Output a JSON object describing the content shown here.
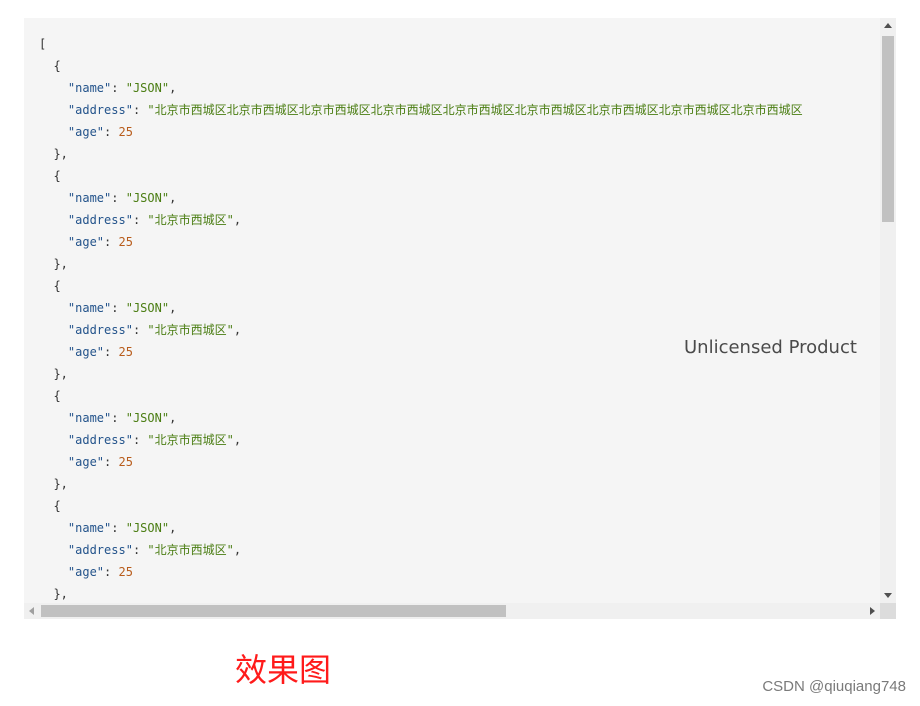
{
  "viewer": {
    "watermark": "Unlicensed Product",
    "lines": [
      [
        {
          "t": "p",
          "v": "["
        }
      ],
      [
        {
          "t": "p",
          "v": "  {"
        }
      ],
      [
        {
          "t": "p",
          "v": "    "
        },
        {
          "t": "k",
          "v": "\"name\""
        },
        {
          "t": "p",
          "v": ": "
        },
        {
          "t": "s",
          "v": "\"JSON\""
        },
        {
          "t": "p",
          "v": ","
        }
      ],
      [
        {
          "t": "p",
          "v": "    "
        },
        {
          "t": "k",
          "v": "\"address\""
        },
        {
          "t": "p",
          "v": ": "
        },
        {
          "t": "s",
          "v": "\"北京市西城区北京市西城区北京市西城区北京市西城区北京市西城区北京市西城区北京市西城区北京市西城区北京市西城区"
        }
      ],
      [
        {
          "t": "p",
          "v": "    "
        },
        {
          "t": "k",
          "v": "\"age\""
        },
        {
          "t": "p",
          "v": ": "
        },
        {
          "t": "n",
          "v": "25"
        }
      ],
      [
        {
          "t": "p",
          "v": "  },"
        }
      ],
      [
        {
          "t": "p",
          "v": "  {"
        }
      ],
      [
        {
          "t": "p",
          "v": "    "
        },
        {
          "t": "k",
          "v": "\"name\""
        },
        {
          "t": "p",
          "v": ": "
        },
        {
          "t": "s",
          "v": "\"JSON\""
        },
        {
          "t": "p",
          "v": ","
        }
      ],
      [
        {
          "t": "p",
          "v": "    "
        },
        {
          "t": "k",
          "v": "\"address\""
        },
        {
          "t": "p",
          "v": ": "
        },
        {
          "t": "s",
          "v": "\"北京市西城区\""
        },
        {
          "t": "p",
          "v": ","
        }
      ],
      [
        {
          "t": "p",
          "v": "    "
        },
        {
          "t": "k",
          "v": "\"age\""
        },
        {
          "t": "p",
          "v": ": "
        },
        {
          "t": "n",
          "v": "25"
        }
      ],
      [
        {
          "t": "p",
          "v": "  },"
        }
      ],
      [
        {
          "t": "p",
          "v": "  {"
        }
      ],
      [
        {
          "t": "p",
          "v": "    "
        },
        {
          "t": "k",
          "v": "\"name\""
        },
        {
          "t": "p",
          "v": ": "
        },
        {
          "t": "s",
          "v": "\"JSON\""
        },
        {
          "t": "p",
          "v": ","
        }
      ],
      [
        {
          "t": "p",
          "v": "    "
        },
        {
          "t": "k",
          "v": "\"address\""
        },
        {
          "t": "p",
          "v": ": "
        },
        {
          "t": "s",
          "v": "\"北京市西城区\""
        },
        {
          "t": "p",
          "v": ","
        }
      ],
      [
        {
          "t": "p",
          "v": "    "
        },
        {
          "t": "k",
          "v": "\"age\""
        },
        {
          "t": "p",
          "v": ": "
        },
        {
          "t": "n",
          "v": "25"
        }
      ],
      [
        {
          "t": "p",
          "v": "  },"
        }
      ],
      [
        {
          "t": "p",
          "v": "  {"
        }
      ],
      [
        {
          "t": "p",
          "v": "    "
        },
        {
          "t": "k",
          "v": "\"name\""
        },
        {
          "t": "p",
          "v": ": "
        },
        {
          "t": "s",
          "v": "\"JSON\""
        },
        {
          "t": "p",
          "v": ","
        }
      ],
      [
        {
          "t": "p",
          "v": "    "
        },
        {
          "t": "k",
          "v": "\"address\""
        },
        {
          "t": "p",
          "v": ": "
        },
        {
          "t": "s",
          "v": "\"北京市西城区\""
        },
        {
          "t": "p",
          "v": ","
        }
      ],
      [
        {
          "t": "p",
          "v": "    "
        },
        {
          "t": "k",
          "v": "\"age\""
        },
        {
          "t": "p",
          "v": ": "
        },
        {
          "t": "n",
          "v": "25"
        }
      ],
      [
        {
          "t": "p",
          "v": "  },"
        }
      ],
      [
        {
          "t": "p",
          "v": "  {"
        }
      ],
      [
        {
          "t": "p",
          "v": "    "
        },
        {
          "t": "k",
          "v": "\"name\""
        },
        {
          "t": "p",
          "v": ": "
        },
        {
          "t": "s",
          "v": "\"JSON\""
        },
        {
          "t": "p",
          "v": ","
        }
      ],
      [
        {
          "t": "p",
          "v": "    "
        },
        {
          "t": "k",
          "v": "\"address\""
        },
        {
          "t": "p",
          "v": ": "
        },
        {
          "t": "s",
          "v": "\"北京市西城区\""
        },
        {
          "t": "p",
          "v": ","
        }
      ],
      [
        {
          "t": "p",
          "v": "    "
        },
        {
          "t": "k",
          "v": "\"age\""
        },
        {
          "t": "p",
          "v": ": "
        },
        {
          "t": "n",
          "v": "25"
        }
      ],
      [
        {
          "t": "p",
          "v": "  },"
        }
      ]
    ]
  },
  "caption": "效果图",
  "credit": "CSDN @qiuqiang748",
  "colors": {
    "key": "#23538b",
    "string": "#4a7d12",
    "number": "#b85c1b",
    "caption": "#ff1a1a"
  }
}
